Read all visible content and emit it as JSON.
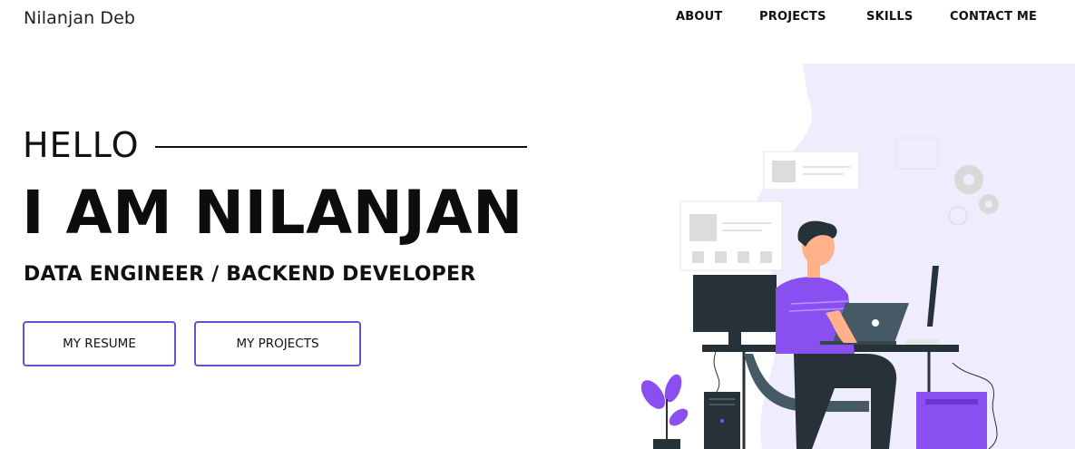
{
  "header": {
    "brand": "Nilanjan Deb",
    "nav": [
      "ABOUT",
      "PROJECTS",
      "SKILLS",
      "CONTACT ME"
    ]
  },
  "hero": {
    "greeting": "HELLO",
    "headline": "I AM NILANJAN",
    "role": "DATA ENGINEER / BACKEND DEVELOPER",
    "buttons": {
      "resume": "MY RESUME",
      "projects": "MY PROJECTS"
    }
  },
  "colors": {
    "accent": "#6a4fd3",
    "blob": "#efedfd",
    "shirt": "#8a4ff0",
    "dark": "#263238"
  }
}
